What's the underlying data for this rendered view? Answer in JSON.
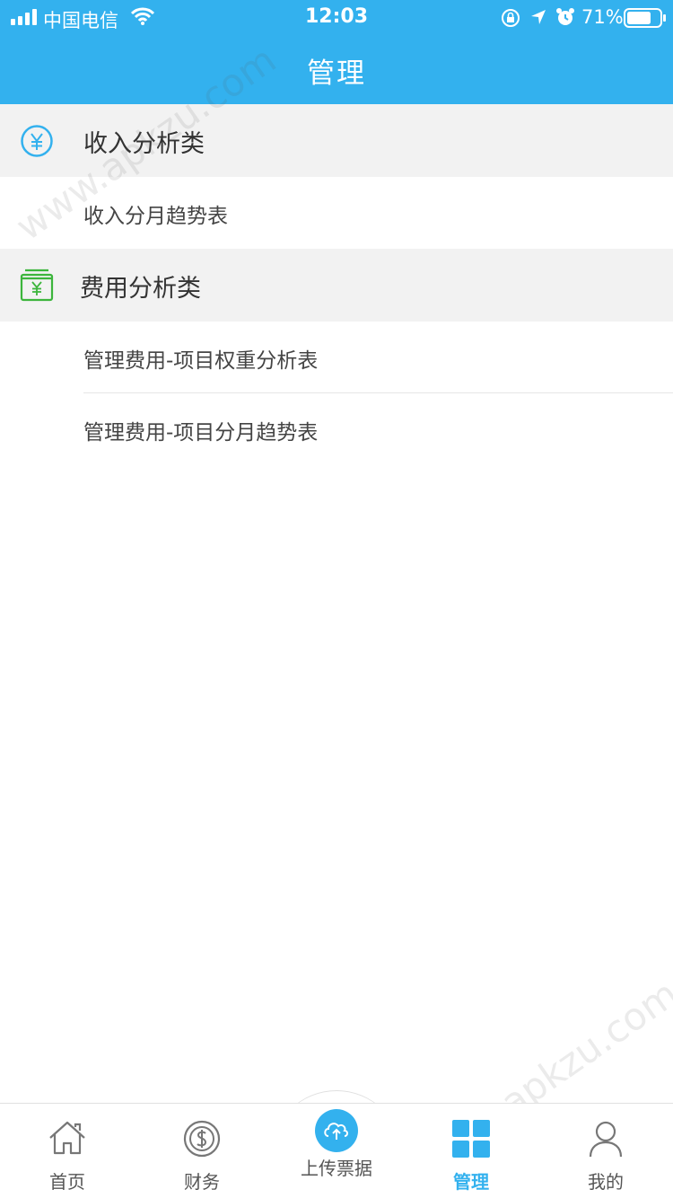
{
  "status_bar": {
    "carrier": "中国电信",
    "time": "12:03",
    "battery_percent": "71%"
  },
  "nav": {
    "title": "管理"
  },
  "sections": [
    {
      "label": "收入分析类",
      "icon": "yen-circle-icon",
      "items": [
        {
          "label": "收入分月趋势表"
        }
      ]
    },
    {
      "label": "费用分析类",
      "icon": "yen-wallet-icon",
      "items": [
        {
          "label": "管理费用-项目权重分析表"
        },
        {
          "label": "管理费用-项目分月趋势表"
        }
      ]
    }
  ],
  "tabbar": {
    "tabs": [
      {
        "label": "首页",
        "icon": "home-icon",
        "active": false
      },
      {
        "label": "财务",
        "icon": "dollar-coin-icon",
        "active": false
      },
      {
        "label": "上传票据",
        "icon": "cloud-upload-icon",
        "active": false
      },
      {
        "label": "管理",
        "icon": "grid-icon",
        "active": true
      },
      {
        "label": "我的",
        "icon": "person-icon",
        "active": false
      }
    ]
  },
  "watermark": "www.apkzu.com",
  "colors": {
    "accent": "#33b1ee",
    "fee_icon": "#3cb53c",
    "section_bg": "#f2f2f2"
  }
}
